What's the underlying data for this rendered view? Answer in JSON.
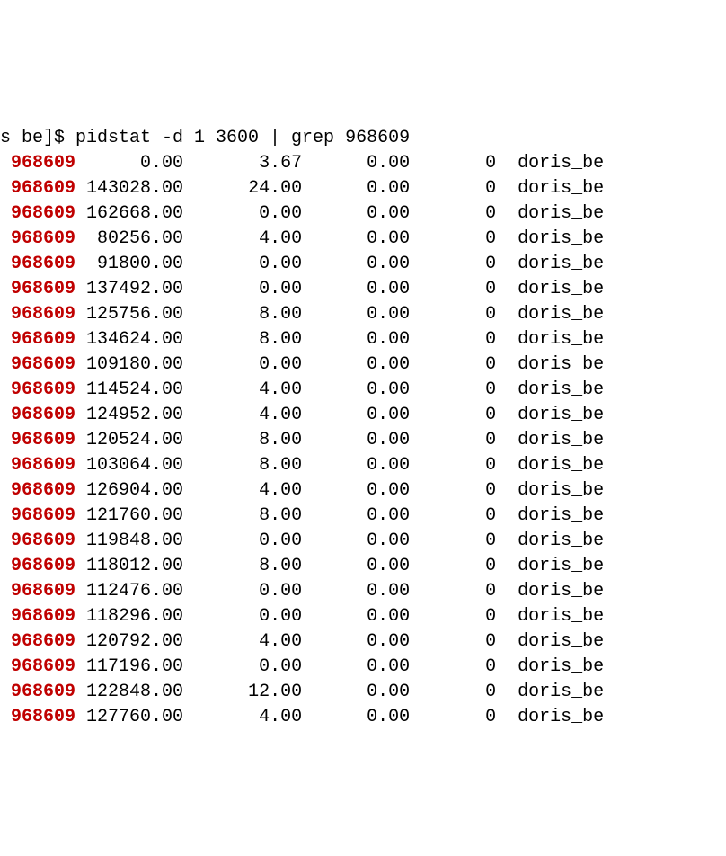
{
  "prompt_prefix": "s be]$ ",
  "command": "pidstat -d 1 3600 | grep 968609",
  "pid": "968609",
  "process_name": "doris_be",
  "rows": [
    {
      "c1": "0.00",
      "c2": "3.67",
      "c3": "0.00",
      "c4": "0"
    },
    {
      "c1": "143028.00",
      "c2": "24.00",
      "c3": "0.00",
      "c4": "0"
    },
    {
      "c1": "162668.00",
      "c2": "0.00",
      "c3": "0.00",
      "c4": "0"
    },
    {
      "c1": "80256.00",
      "c2": "4.00",
      "c3": "0.00",
      "c4": "0"
    },
    {
      "c1": "91800.00",
      "c2": "0.00",
      "c3": "0.00",
      "c4": "0"
    },
    {
      "c1": "137492.00",
      "c2": "0.00",
      "c3": "0.00",
      "c4": "0"
    },
    {
      "c1": "125756.00",
      "c2": "8.00",
      "c3": "0.00",
      "c4": "0"
    },
    {
      "c1": "134624.00",
      "c2": "8.00",
      "c3": "0.00",
      "c4": "0"
    },
    {
      "c1": "109180.00",
      "c2": "0.00",
      "c3": "0.00",
      "c4": "0"
    },
    {
      "c1": "114524.00",
      "c2": "4.00",
      "c3": "0.00",
      "c4": "0"
    },
    {
      "c1": "124952.00",
      "c2": "4.00",
      "c3": "0.00",
      "c4": "0"
    },
    {
      "c1": "120524.00",
      "c2": "8.00",
      "c3": "0.00",
      "c4": "0"
    },
    {
      "c1": "103064.00",
      "c2": "8.00",
      "c3": "0.00",
      "c4": "0"
    },
    {
      "c1": "126904.00",
      "c2": "4.00",
      "c3": "0.00",
      "c4": "0"
    },
    {
      "c1": "121760.00",
      "c2": "8.00",
      "c3": "0.00",
      "c4": "0"
    },
    {
      "c1": "119848.00",
      "c2": "0.00",
      "c3": "0.00",
      "c4": "0"
    },
    {
      "c1": "118012.00",
      "c2": "8.00",
      "c3": "0.00",
      "c4": "0"
    },
    {
      "c1": "112476.00",
      "c2": "0.00",
      "c3": "0.00",
      "c4": "0"
    },
    {
      "c1": "118296.00",
      "c2": "0.00",
      "c3": "0.00",
      "c4": "0"
    },
    {
      "c1": "120792.00",
      "c2": "4.00",
      "c3": "0.00",
      "c4": "0"
    },
    {
      "c1": "117196.00",
      "c2": "0.00",
      "c3": "0.00",
      "c4": "0"
    },
    {
      "c1": "122848.00",
      "c2": "12.00",
      "c3": "0.00",
      "c4": "0"
    },
    {
      "c1": "127760.00",
      "c2": "4.00",
      "c3": "0.00",
      "c4": "0"
    }
  ]
}
